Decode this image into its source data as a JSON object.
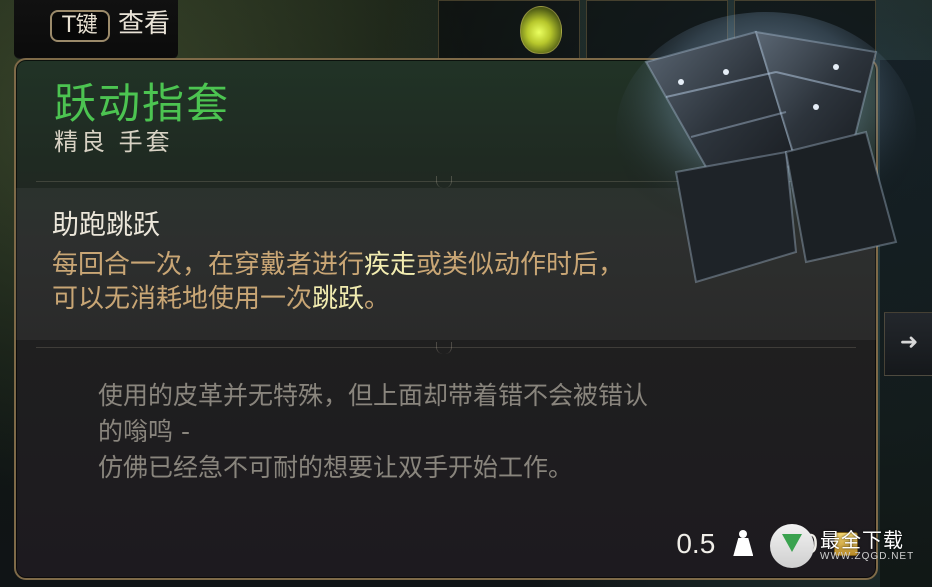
{
  "hint": {
    "key_label": "T键",
    "action_label": "查看"
  },
  "item": {
    "name": "跃动指套",
    "subtitle": "精良 手套",
    "name_color": "#4cc451"
  },
  "ability": {
    "name": "助跑跳跃",
    "desc_part1": "每回合一次，在穿戴者进行",
    "desc_kw1": "疾走",
    "desc_part2": "或类似动作时后，",
    "desc_part3": "可以无消耗地使用一次",
    "desc_kw2": "跳跃",
    "desc_part4": "。",
    "text_color": "#c9a675",
    "keyword_color": "#f2ecb0"
  },
  "lore": {
    "line1": "使用的皮革并无特殊，但上面却带着错不会被错认",
    "line2": "的嗡鸣 -",
    "line3": "仿佛已经急不可耐的想要让双手开始工作。"
  },
  "footer": {
    "weight": "0.5",
    "value": "330",
    "weight_icon": "weight-icon",
    "coin_icon": "coin-icon"
  },
  "side": {
    "arrow_icon": "arrow-right-icon"
  },
  "watermark": {
    "title": "最全下载",
    "url": "WWW.ZQGD.NET"
  }
}
